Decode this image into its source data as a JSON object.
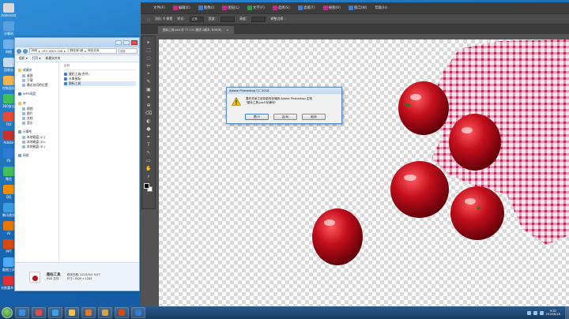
{
  "desktop": {
    "icons": [
      {
        "label": "Administr",
        "color": "#d9d9d9"
      },
      {
        "label": "计算机",
        "color": "#5aa0e0"
      },
      {
        "label": "网络",
        "color": "#6fb0ea"
      },
      {
        "label": "回收站",
        "color": "#c6dbef"
      },
      {
        "label": "控制面板",
        "color": "#f0b44a"
      },
      {
        "label": "360安全",
        "color": "#3fbf5a"
      },
      {
        "label": "FLV",
        "color": "#e64a3b"
      },
      {
        "label": "Adobe",
        "color": "#c7322b"
      },
      {
        "label": "PS",
        "color": "#2f7bd6"
      },
      {
        "label": "微信",
        "color": "#40c057"
      },
      {
        "label": "QQ",
        "color": "#f08c00"
      },
      {
        "label": "腾讯视频",
        "color": "#3b9ce0"
      },
      {
        "label": "AI",
        "color": "#e67700"
      },
      {
        "label": "PPT",
        "color": "#d9480f"
      },
      {
        "label": "截图工具",
        "color": "#4dabf7"
      },
      {
        "label": "光影魔术手",
        "color": "#e03131"
      }
    ]
  },
  "explorer": {
    "address": [
      "网络",
      "192.168.0.106",
      "工程电商u盘",
      "网店仓库"
    ],
    "search_placeholder": "搜索",
    "toolbar": [
      "组织 ▾",
      "打开 ▾",
      "新建文件夹"
    ],
    "nav_groups": [
      {
        "title": "收藏夹",
        "color": "#f2c14e",
        "items": [
          "桌面",
          "下载",
          "最近访问的位置"
        ]
      },
      {
        "title": "WPS网盘",
        "color": "#3b82c4",
        "items": []
      },
      {
        "title": "库",
        "color": "#f2c14e",
        "items": [
          "视频",
          "图片",
          "文档",
          "音乐"
        ]
      },
      {
        "title": "计算机",
        "color": "#7a9bbf",
        "items": [
          "本地磁盘 (C:)",
          "本地磁盘 (D:)",
          "本地磁盘 (E:)"
        ]
      },
      {
        "title": "网络",
        "color": "#6a9ed6",
        "items": []
      }
    ],
    "list_header": "名称",
    "files": [
      "酸奶工具(合并)",
      "水果图标",
      "图标工具"
    ],
    "selected_index": 2,
    "details": {
      "name": "图标工具",
      "type": "PSD 文件",
      "modified": "修改日期: 2015/5/5 9:07",
      "size": "尺寸: 1920 x 1281"
    }
  },
  "photoshop": {
    "menu": [
      {
        "label": "文件(F)",
        "icon_color": ""
      },
      {
        "label": "编辑(E)",
        "icon_color": "#c42b8a"
      },
      {
        "label": "图像(I)",
        "icon_color": "#3a7fd5"
      },
      {
        "label": "图层(L)",
        "icon_color": "#c42b8a"
      },
      {
        "label": "文字(Y)",
        "icon_color": "#2d9c4b"
      },
      {
        "label": "选择(S)",
        "icon_color": "#c42b8a"
      },
      {
        "label": "滤镜(T)",
        "icon_color": "#3a7fd5"
      },
      {
        "label": "视图(V)",
        "icon_color": "#c42b8a"
      },
      {
        "label": "窗口(W)",
        "icon_color": "#3a7fd5"
      },
      {
        "label": "帮助(H)",
        "icon_color": ""
      }
    ],
    "options": {
      "feather": "羽化: 0 像素",
      "style_label": "样式:",
      "style_value": "正常",
      "width": "宽度:",
      "height": "高度:",
      "refine": "调整边缘..."
    },
    "tab": {
      "title": "图标工具.psd @ 77.1% (图层 0副本, RGB/8)",
      "close": "×"
    },
    "tools": [
      "▸",
      "⬚",
      "◌",
      "✂",
      "⌖",
      "✎",
      "▣",
      "✦",
      "⊕",
      "⌫",
      "◐",
      "●",
      "✒",
      "T",
      "↖",
      "▭",
      "✋",
      "⌕"
    ]
  },
  "dialog": {
    "title": "Adobe Photoshop CC 2016",
    "message_line1": "要在关闭之前将更改存储到 Adobe Photoshop 文档",
    "message_line2": "\"图标工具.psd\"存储吗?",
    "buttons": {
      "yes": "是(Y)",
      "no": "否(N)",
      "cancel": "取消"
    }
  },
  "taskbar": {
    "apps": [
      {
        "name": "ie",
        "color": "#3b8be0"
      },
      {
        "name": "360",
        "color": "#e34b4b"
      },
      {
        "name": "qq",
        "color": "#3aa0e8"
      },
      {
        "name": "explorer",
        "color": "#f2c14e"
      },
      {
        "name": "media",
        "color": "#e07b2a"
      },
      {
        "name": "folder",
        "color": "#d4a34a"
      },
      {
        "name": "ppt",
        "color": "#d9480f"
      },
      {
        "name": "ps",
        "color": "#2f7bd6"
      }
    ],
    "time": "9:30",
    "date": "2016/6/28"
  }
}
